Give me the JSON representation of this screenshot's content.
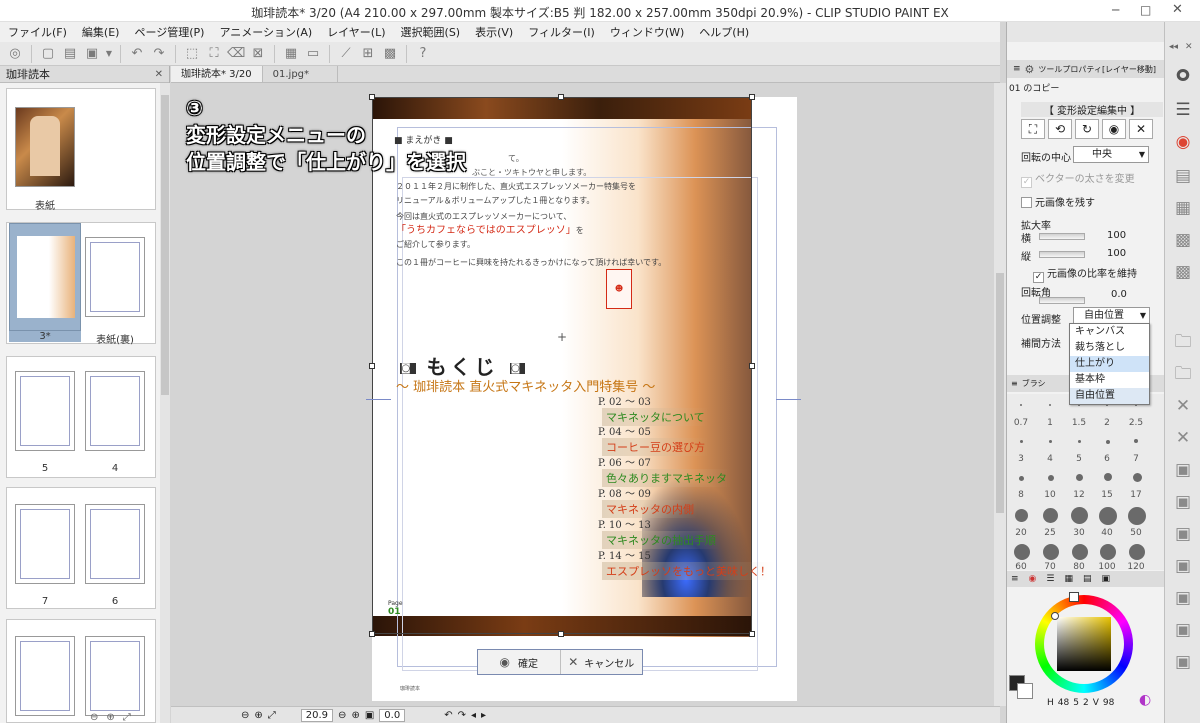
{
  "window": {
    "title": "珈琲読本* 3/20 (A4 210.00 x 297.00mm 製本サイズ:B5 判 182.00 x 257.00mm 350dpi 20.9%)  - CLIP STUDIO PAINT EX"
  },
  "menu": [
    "ファイル(F)",
    "編集(E)",
    "ページ管理(P)",
    "アニメーション(A)",
    "レイヤー(L)",
    "選択範囲(S)",
    "表示(V)",
    "フィルター(I)",
    "ウィンドウ(W)",
    "ヘルプ(H)"
  ],
  "page_manager": {
    "tab": "珈琲読本",
    "pages": [
      {
        "label": "表紙"
      },
      {
        "label": "3*"
      },
      {
        "label": "表紙(裏)"
      },
      {
        "label": "5"
      },
      {
        "label": "4"
      },
      {
        "label": "7"
      },
      {
        "label": "6"
      }
    ]
  },
  "doc_tabs": [
    {
      "label": "珈琲読本*  3/20"
    },
    {
      "label": "01.jpg*"
    }
  ],
  "annotation": {
    "number": "③",
    "line1": "変形設定メニューの",
    "line2": "位置調整で「仕上がり」を選択"
  },
  "document": {
    "preface_heading": "■ まえがき ■",
    "preface_lines": [
      "て。",
      "ぶこと・ツキトウヤと申します。",
      "２０１１年２月に制作した、直火式エスプレッソメーカー特集号を",
      "リニューアル＆ボリュームアップした１冊となります。",
      "今回は直火式のエスプレッソメーカーについて、"
    ],
    "highlight": "「うちカフェならではのエスプレッソ」",
    "highlight_suffix": "を",
    "intro_line": "ご紹介して参ります。",
    "closing": "この１冊がコーヒーに興味を持たれるきっかけになって頂ければ幸いです。",
    "toc_title": "もくじ",
    "toc_subtitle": "～ 珈琲読本 直火式マキネッタ入門特集号 ～",
    "toc": [
      {
        "pages": "P. 02 ～ 03",
        "title": "マキネッタについて"
      },
      {
        "pages": "P. 04 ～ 05",
        "title": "コーヒー豆の選び方"
      },
      {
        "pages": "P. 06 ～ 07",
        "title": "色々ありますマキネッタ"
      },
      {
        "pages": "P. 08 ～ 09",
        "title": "マキネッタの内側"
      },
      {
        "pages": "P. 10 ～ 13",
        "title": "マキネッタの抽出手順"
      },
      {
        "pages": "P. 14 ～ 15",
        "title": "エスプレッソをもっと美味しく！"
      }
    ],
    "page_label": "Page",
    "page_number": "01",
    "footer": "珈琲読本"
  },
  "transform_bar": {
    "confirm": "確定",
    "cancel": "キャンセル"
  },
  "status": {
    "zoom": "20.9",
    "angle": "0.0"
  },
  "tool_property": {
    "panel_title": "ツールプロパティ[レイヤー移動]",
    "layer_name": "01 のコピー",
    "header": "【 変形設定編集中 】",
    "rotation_center_label": "回転の中心",
    "rotation_center_value": "中央",
    "vector_width_label": "ベクターの太さを変更",
    "keep_original_label": "元画像を残す",
    "scale_label": "拡大率",
    "width_label": "横",
    "width_value": "100",
    "height_label": "縦",
    "height_value": "100",
    "keep_ratio_label": "元画像の比率を維持",
    "rotation_label": "回転角",
    "rotation_value": "0.0",
    "position_label": "位置調整",
    "position_value": "自由位置",
    "interp_label": "補間方法",
    "position_options": [
      "キャンバス",
      "裁ち落とし",
      "仕上がり",
      "基本枠",
      "自由位置"
    ],
    "position_highlight": "仕上がり"
  },
  "brush_size": {
    "tab": "ブラシ",
    "sizes": [
      "0.7",
      "1",
      "1.5",
      "2",
      "2.5",
      "3",
      "4",
      "5",
      "6",
      "7",
      "8",
      "10",
      "12",
      "15",
      "17",
      "20",
      "25",
      "30",
      "40",
      "50",
      "60",
      "70",
      "80",
      "100",
      "120"
    ]
  },
  "color": {
    "values": [
      "48",
      "5",
      "2",
      "98"
    ],
    "labels": [
      "H",
      "S",
      "V"
    ],
    "main_color": "#262626",
    "sub_color": "#ffffff"
  }
}
